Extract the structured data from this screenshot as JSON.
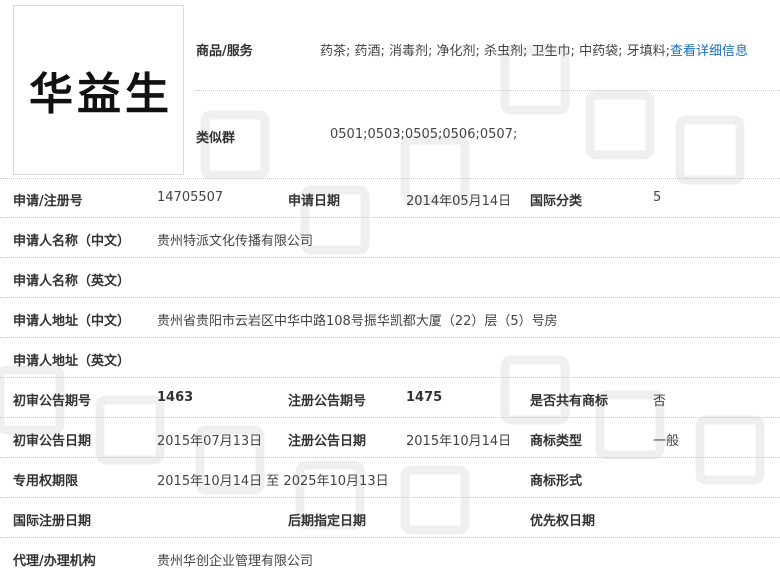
{
  "logo": {
    "chars": [
      "华",
      "益",
      "生"
    ]
  },
  "goods": {
    "label": "商品/服务",
    "value": "药茶; 药酒; 消毒剂; 净化剂; 杀虫剂; 卫生巾; 中药袋; 牙填料;",
    "link_label": "查看详细信息"
  },
  "similar_group": {
    "label": "类似群",
    "value": "0501;0503;0505;0506;0507;"
  },
  "rows": {
    "reg_no": {
      "label": "申请/注册号",
      "value": "14705507"
    },
    "apply_date": {
      "label": "申请日期",
      "value": "2014年05月14日"
    },
    "intl_class": {
      "label": "国际分类",
      "value": "5"
    },
    "applicant_cn": {
      "label": "申请人名称（中文）",
      "value": "贵州特派文化传播有限公司"
    },
    "applicant_en": {
      "label": "申请人名称（英文）",
      "value": ""
    },
    "address_cn": {
      "label": "申请人地址（中文）",
      "value": "贵州省贵阳市云岩区中华中路108号振华凯都大厦（22）层（5）号房"
    },
    "address_en": {
      "label": "申请人地址（英文）",
      "value": ""
    },
    "prelim_issue": {
      "label": "初审公告期号",
      "value": "1463"
    },
    "reg_issue": {
      "label": "注册公告期号",
      "value": "1475"
    },
    "shared": {
      "label": "是否共有商标",
      "value": "否"
    },
    "prelim_date": {
      "label": "初审公告日期",
      "value": "2015年07月13日"
    },
    "reg_date": {
      "label": "注册公告日期",
      "value": "2015年10月14日"
    },
    "tm_type": {
      "label": "商标类型",
      "value": "一般"
    },
    "exclusive_period": {
      "label": "专用权期限",
      "value": "2015年10月14日 至 2025年10月13日"
    },
    "tm_form": {
      "label": "商标形式",
      "value": ""
    },
    "intl_reg_date": {
      "label": "国际注册日期",
      "value": ""
    },
    "late_designation": {
      "label": "后期指定日期",
      "value": ""
    },
    "priority_date": {
      "label": "优先权日期",
      "value": ""
    },
    "agent": {
      "label": "代理/办理机构",
      "value": "贵州华创企业管理有限公司"
    }
  },
  "colors": {
    "link": "#1a6fb8",
    "divider": "#c8c8c8",
    "watermark": "#f2f2f2"
  }
}
